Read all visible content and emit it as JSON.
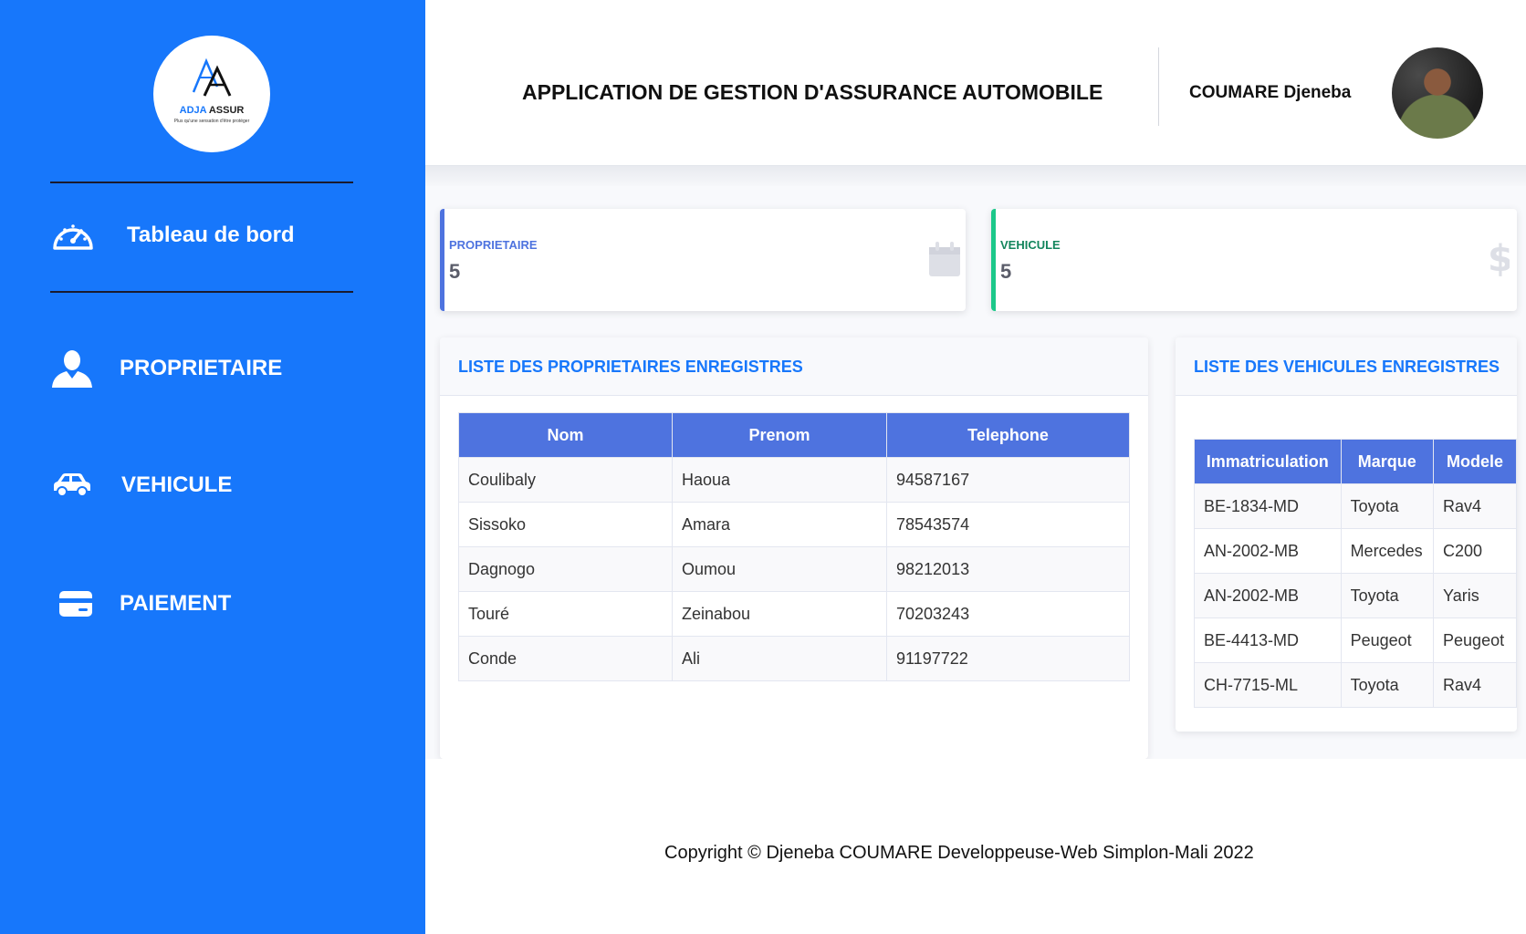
{
  "brand": {
    "name_part1": "ADJA",
    "name_part2": "ASSUR",
    "tagline": "Plus qu'une sensation d'être protéger"
  },
  "sidebar": {
    "items": [
      {
        "label": "Tableau de bord",
        "icon": "dashboard-gauge-icon"
      },
      {
        "label": "PROPRIETAIRE",
        "icon": "user-icon"
      },
      {
        "label": "VEHICULE",
        "icon": "car-icon"
      },
      {
        "label": "PAIEMENT",
        "icon": "credit-card-icon"
      }
    ]
  },
  "header": {
    "title": "APPLICATION DE GESTION D'ASSURANCE AUTOMOBILE",
    "user_name": "COUMARE Djeneba"
  },
  "stats": [
    {
      "label": "PROPRIETAIRE",
      "value": "5",
      "color": "#4e73df",
      "icon": "calendar-icon"
    },
    {
      "label": "VEHICULE",
      "value": "5",
      "color": "#1cc88a",
      "icon": "dollar-icon"
    }
  ],
  "owners": {
    "title": "LISTE DES PROPRIETAIRES ENREGISTRES",
    "columns": [
      "Nom",
      "Prenom",
      "Telephone"
    ],
    "rows": [
      [
        "Coulibaly",
        "Haoua",
        "94587167"
      ],
      [
        "Sissoko",
        "Amara",
        "78543574"
      ],
      [
        "Dagnogo",
        "Oumou",
        "98212013"
      ],
      [
        "Touré",
        "Zeinabou",
        "70203243"
      ],
      [
        "Conde",
        "Ali",
        "91197722"
      ]
    ]
  },
  "vehicles": {
    "title": "LISTE DES VEHICULES ENREGISTRES",
    "columns": [
      "Immatriculation",
      "Marque",
      "Modele"
    ],
    "rows": [
      [
        "BE-1834-MD",
        "Toyota",
        "Rav4"
      ],
      [
        "AN-2002-MB",
        "Mercedes",
        "C200"
      ],
      [
        "AN-2002-MB",
        "Toyota",
        "Yaris"
      ],
      [
        "BE-4413-MD",
        "Peugeot",
        "Peugeot"
      ],
      [
        "CH-7715-ML",
        "Toyota",
        "Rav4"
      ]
    ]
  },
  "footer": {
    "copyright": "Copyright © Djeneba COUMARE Developpeuse-Web Simplon-Mali 2022"
  },
  "colors": {
    "sidebar": "#1777fb",
    "table_header": "#4e73df",
    "accent_primary": "#4e73df",
    "accent_success": "#1cc88a"
  }
}
